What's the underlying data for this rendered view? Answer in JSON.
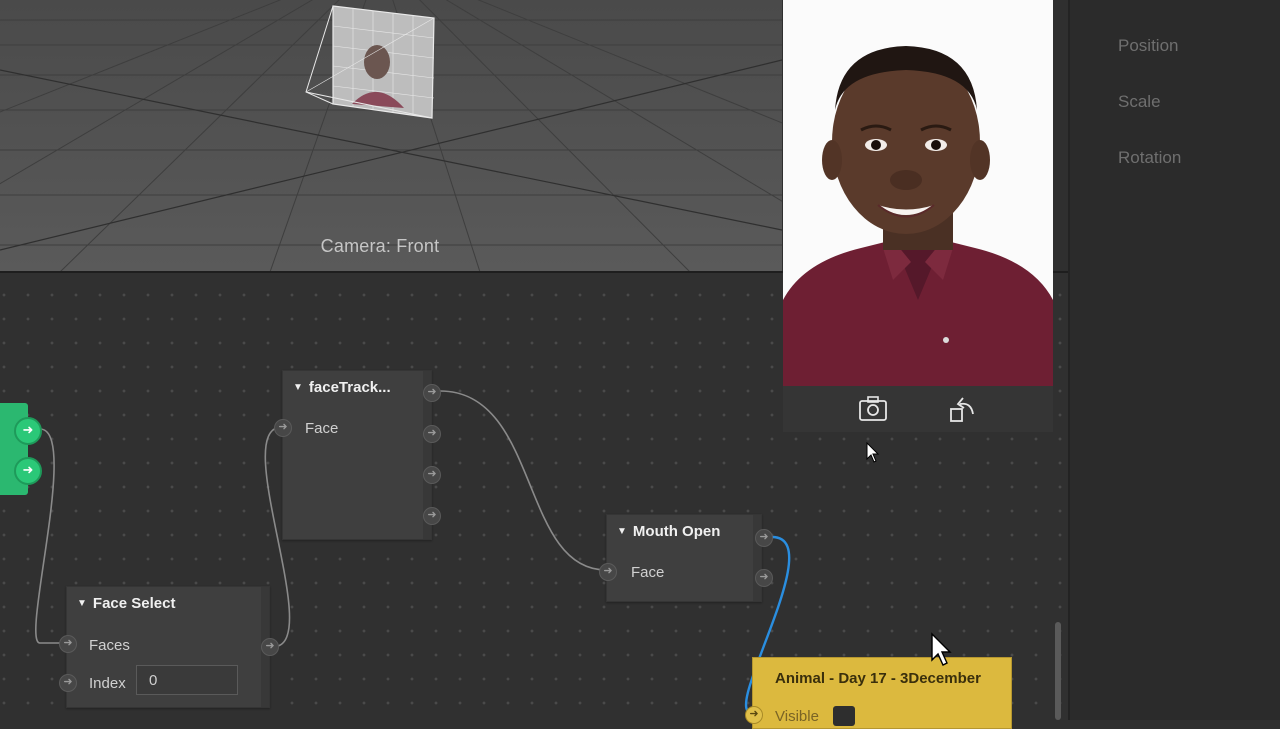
{
  "viewport": {
    "camera_label": "Camera: Front"
  },
  "inspector": {
    "position_label": "Position",
    "scale_label": "Scale",
    "rotation_label": "Rotation"
  },
  "nodes": {
    "face_tracker": {
      "title": "faceTrack...",
      "input_label": "Face"
    },
    "mouth_open": {
      "title": "Mouth Open",
      "input_label": "Face"
    },
    "face_select": {
      "title": "Face Select",
      "faces_label": "Faces",
      "index_label": "Index",
      "index_value": "0"
    },
    "animal": {
      "title": "Animal - Day 17 - 3December",
      "visible_label": "Visible"
    }
  },
  "preview_toolbar": {
    "switch_camera_icon": "camera-switch-icon",
    "rotate_icon": "rotate-device-icon"
  },
  "colors": {
    "green_node": "#2bb870",
    "yellow_node": "#dcb93e",
    "wire_active": "#2a8ee0",
    "wire_default": "#8a8a8a"
  }
}
